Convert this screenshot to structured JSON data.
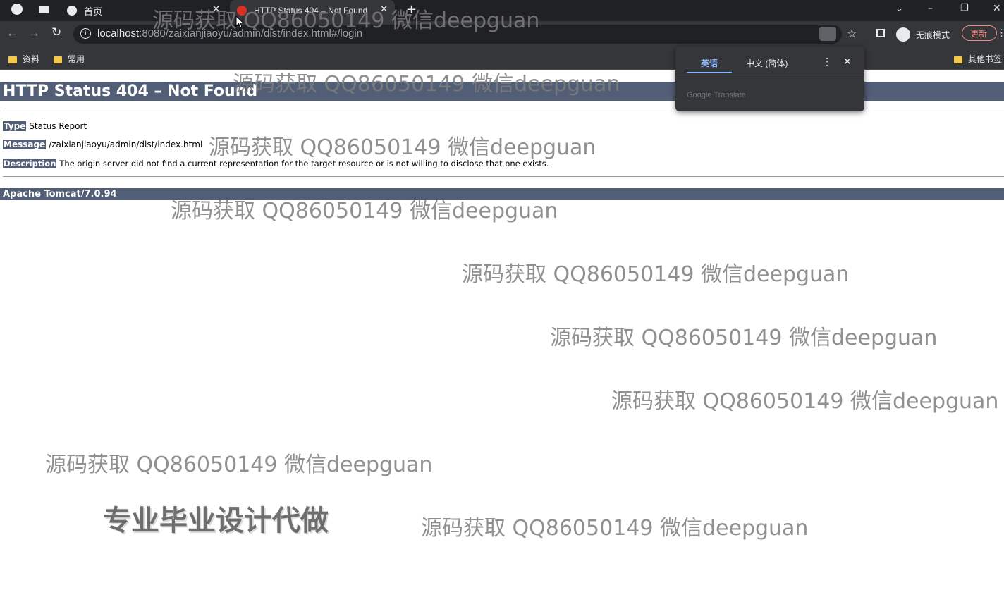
{
  "tabs": [
    {
      "label": "首页"
    },
    {
      "label": "HTTP Status 404 – Not Found"
    }
  ],
  "address": {
    "host": "localhost",
    "rest": ":8080/zaixianjiaoyu/admin/dist/index.html#/login"
  },
  "toolbar": {
    "incognito_label": "无痕模式",
    "update_label": "更新"
  },
  "bookmarks": {
    "items": [
      {
        "label": "资料"
      },
      {
        "label": "常用"
      }
    ],
    "other_label": "其他书签"
  },
  "translate": {
    "tab_source": "英语",
    "tab_target": "中文 (简体)",
    "footer": "Google Translate"
  },
  "page": {
    "title": "HTTP Status 404 – Not Found",
    "type_label": "Type",
    "type_value": "Status Report",
    "message_label": "Message",
    "message_value": "/zaixianjiaoyu/admin/dist/index.html",
    "description_label": "Description",
    "description_value": "The origin server did not find a current representation for the target resource or is not willing to disclose that one exists.",
    "server": "Apache Tomcat/7.0.94"
  },
  "watermark": {
    "text": "源码获取 QQ86050149 微信deepguan",
    "promo": "专业毕业设计代做"
  }
}
